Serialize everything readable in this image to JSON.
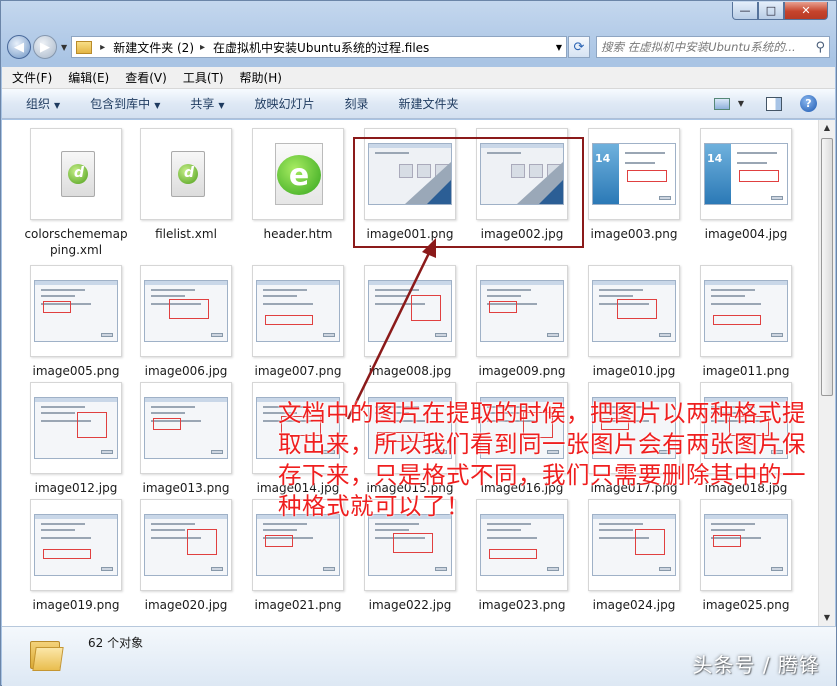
{
  "window": {
    "caption_min": "—",
    "caption_max": "□",
    "caption_close": "✕"
  },
  "address": {
    "crumbs": [
      "新建文件夹 (2)",
      "在虚拟机中安装Ubuntu系统的过程.files"
    ],
    "search_placeholder": "搜索 在虚拟机中安装Ubuntu系统的..."
  },
  "menu": [
    "文件(F)",
    "编辑(E)",
    "查看(V)",
    "工具(T)",
    "帮助(H)"
  ],
  "toolbar": {
    "organize": "组织",
    "include_library": "包含到库中",
    "share": "共享",
    "slideshow": "放映幻灯片",
    "burn": "刻录",
    "new_folder": "新建文件夹"
  },
  "files": [
    {
      "name": "colorschememapping.xml",
      "kind": "dw"
    },
    {
      "name": "filelist.xml",
      "kind": "dw"
    },
    {
      "name": "header.htm",
      "kind": "ie"
    },
    {
      "name": "image001.png",
      "kind": "vm"
    },
    {
      "name": "image002.jpg",
      "kind": "vm"
    },
    {
      "name": "image003.png",
      "kind": "ub"
    },
    {
      "name": "image004.jpg",
      "kind": "ub"
    },
    {
      "name": "image005.png",
      "kind": "ss"
    },
    {
      "name": "image006.jpg",
      "kind": "ss"
    },
    {
      "name": "image007.png",
      "kind": "ss"
    },
    {
      "name": "image008.jpg",
      "kind": "ss"
    },
    {
      "name": "image009.png",
      "kind": "ss"
    },
    {
      "name": "image010.jpg",
      "kind": "ss"
    },
    {
      "name": "image011.png",
      "kind": "ss"
    },
    {
      "name": "image012.jpg",
      "kind": "ss"
    },
    {
      "name": "image013.png",
      "kind": "ss"
    },
    {
      "name": "image014.jpg",
      "kind": "ss"
    },
    {
      "name": "image015.png",
      "kind": "ss"
    },
    {
      "name": "image016.jpg",
      "kind": "ss"
    },
    {
      "name": "image017.png",
      "kind": "ss"
    },
    {
      "name": "image018.jpg",
      "kind": "ss"
    },
    {
      "name": "image019.png",
      "kind": "ss"
    },
    {
      "name": "image020.jpg",
      "kind": "ss"
    },
    {
      "name": "image021.png",
      "kind": "ss"
    },
    {
      "name": "image022.jpg",
      "kind": "ss"
    },
    {
      "name": "image023.png",
      "kind": "ss"
    },
    {
      "name": "image024.jpg",
      "kind": "ss"
    },
    {
      "name": "image025.png",
      "kind": "ss"
    }
  ],
  "ubuntu_badge": "14",
  "annotation": "文档中的图片在提取的时候，把图片以两种格式提取出来，所以我们看到同一张图片会有两张图片保存下来，只是格式不同，我们只需要删除其中的一种格式就可以了！",
  "status": {
    "count": "62 个对象"
  },
  "watermark": "头条号 / 腾锋",
  "colors": {
    "annotation": "#ef1f1f",
    "highlight_box": "#8b1a1a"
  }
}
